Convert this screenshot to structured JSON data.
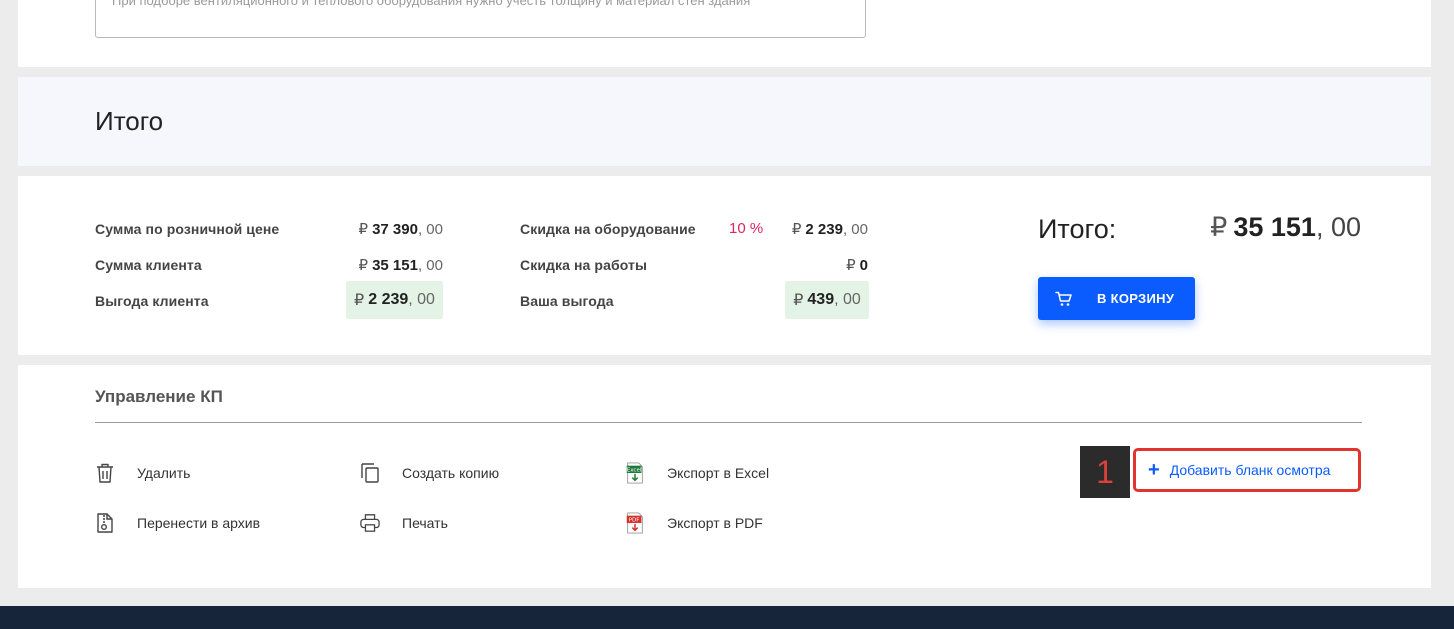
{
  "textarea": {
    "hint": "При подборе вентиляционного и теплового оборудования нужно учесть толщину и материал стен здания"
  },
  "itogo_header": {
    "title": "Итого"
  },
  "summary": {
    "currency": "₽",
    "left": [
      {
        "label": "Сумма по розничной цене",
        "int": "37 390",
        "dec": ", 00"
      },
      {
        "label": "Сумма клиента",
        "int": "35 151",
        "dec": ", 00"
      },
      {
        "label": "Выгода клиента",
        "int": "2 239",
        "dec": ", 00"
      }
    ],
    "middle": [
      {
        "label": "Скидка на оборудование",
        "percent": "10 %",
        "int": "2 239",
        "dec": ", 00"
      },
      {
        "label": "Скидка на работы",
        "int": "0",
        "dec": ""
      },
      {
        "label": "Ваша выгода",
        "int": "439",
        "dec": ", 00"
      }
    ],
    "total": {
      "label": "Итого:",
      "int": "35 151",
      "dec": ", 00"
    },
    "cart_button": {
      "label": "В КОРЗИНУ",
      "icon": "cart-icon"
    }
  },
  "manage": {
    "title": "Управление КП",
    "actions": [
      {
        "label": "Удалить",
        "icon": "trash-icon"
      },
      {
        "label": "Перенести в архив",
        "icon": "archive-icon"
      },
      {
        "label": "Создать копию",
        "icon": "copy-icon"
      },
      {
        "label": "Печать",
        "icon": "printer-icon"
      },
      {
        "label": "Экспорт в Excel",
        "icon": "excel-icon",
        "icon_text": "Excel"
      },
      {
        "label": "Экспорт в PDF",
        "icon": "pdf-icon",
        "icon_text": "PDF"
      }
    ],
    "badge": "1",
    "add_button": {
      "label": "Добавить бланк осмотра",
      "icon": "plus-icon",
      "glyph": "+"
    }
  },
  "colors": {
    "accent": "#0b5cff",
    "highlight_border": "#e0342c",
    "percent": "#e0245e",
    "savings_bg": "#e3f3e5",
    "footer": "#17253a"
  }
}
